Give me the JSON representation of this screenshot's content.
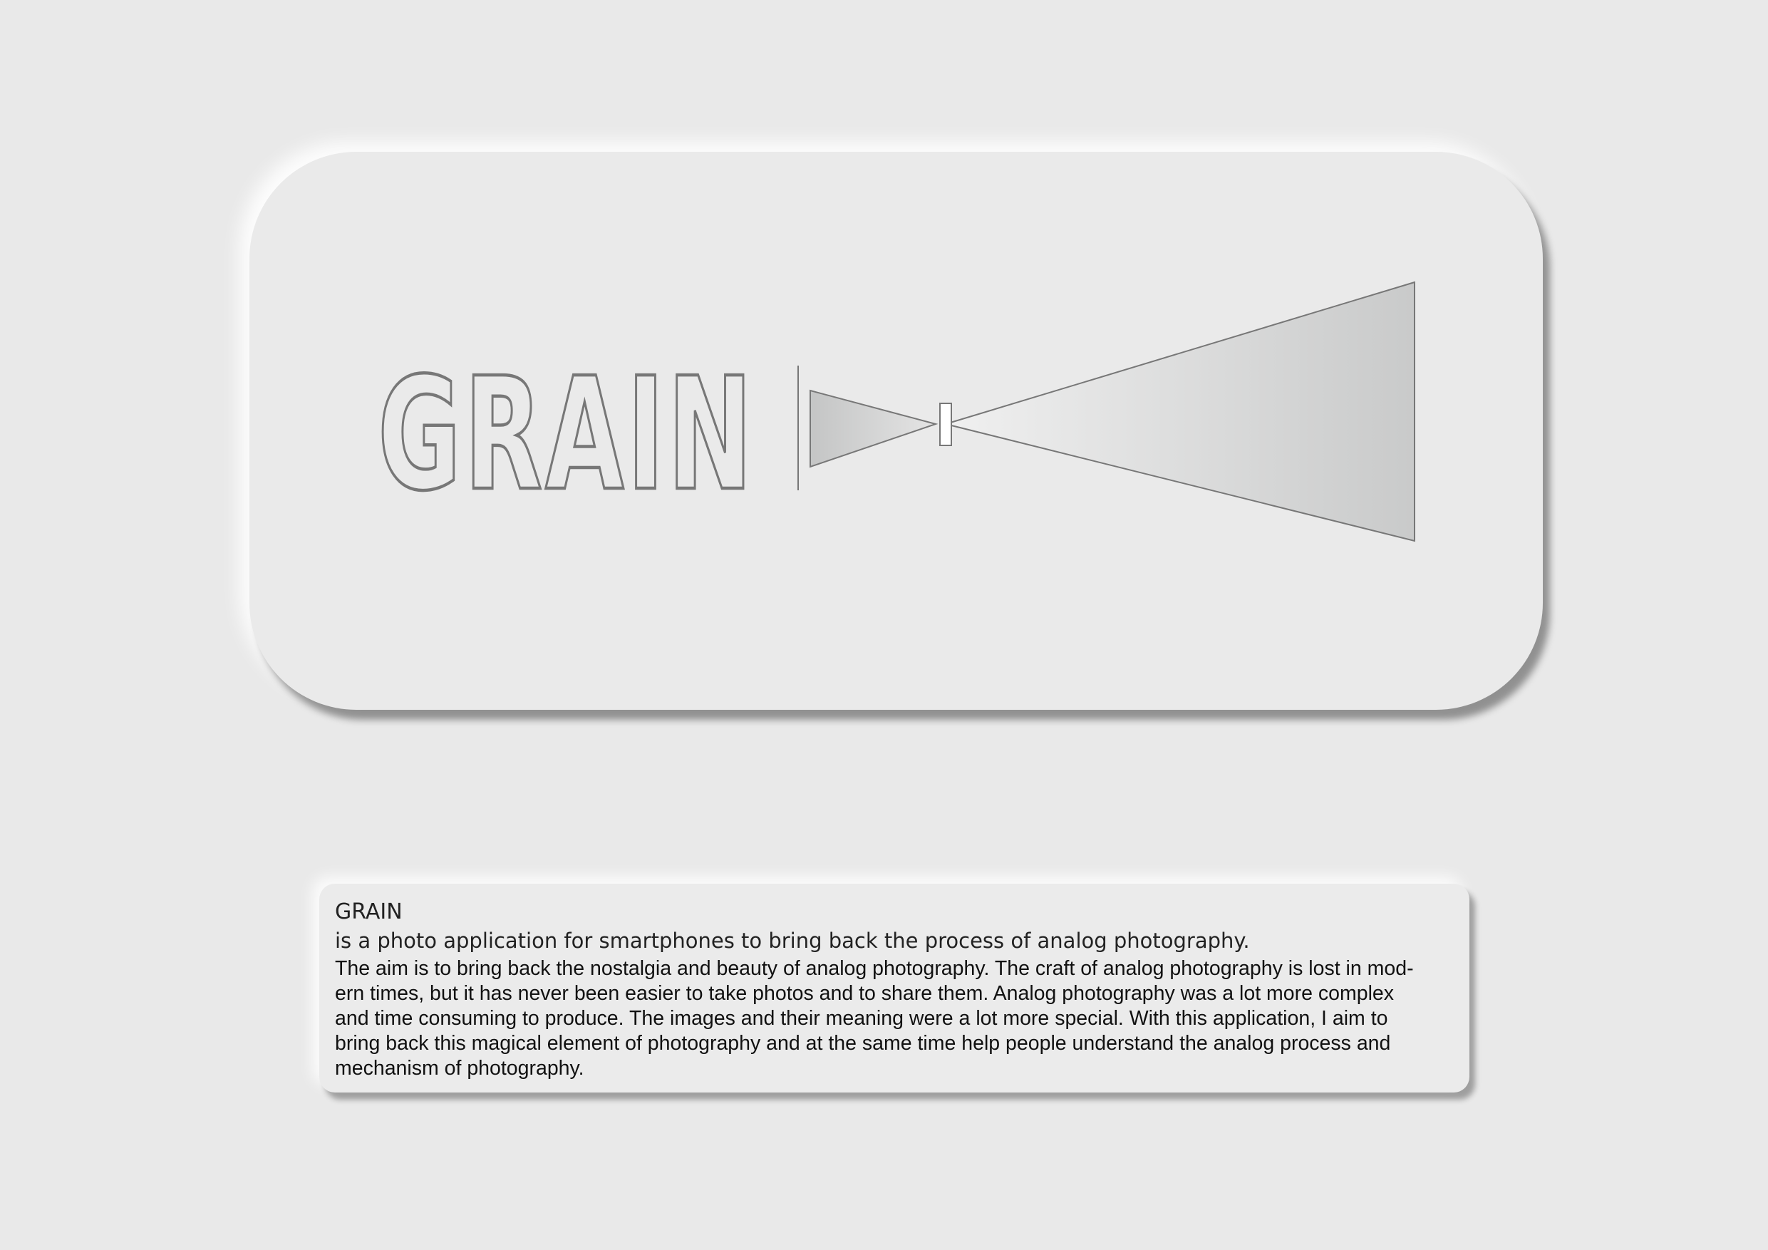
{
  "logo": {
    "wordmark": "GRAIN",
    "mark_icon": "camera-obscura-icon"
  },
  "description": {
    "title": "GRAIN",
    "subtitle": "is a photo application for smartphones to bring back the process of analog photography.",
    "body_lines": [
      "The aim is to bring back the nostalgia and beauty of analog photography. The craft of analog photography is lost in mod-",
      "ern times, but it has never been easier to take photos and to share them. Analog photography was a lot more complex",
      "and time consuming to produce. The images and their meaning were a lot more special. With this application, I aim to",
      "bring back this magical element of photography and at the same time help people understand the analog process and",
      "mechanism of photography."
    ]
  },
  "colors": {
    "background": "#e9e9e9",
    "outline": "#777777",
    "text": "#111111"
  }
}
